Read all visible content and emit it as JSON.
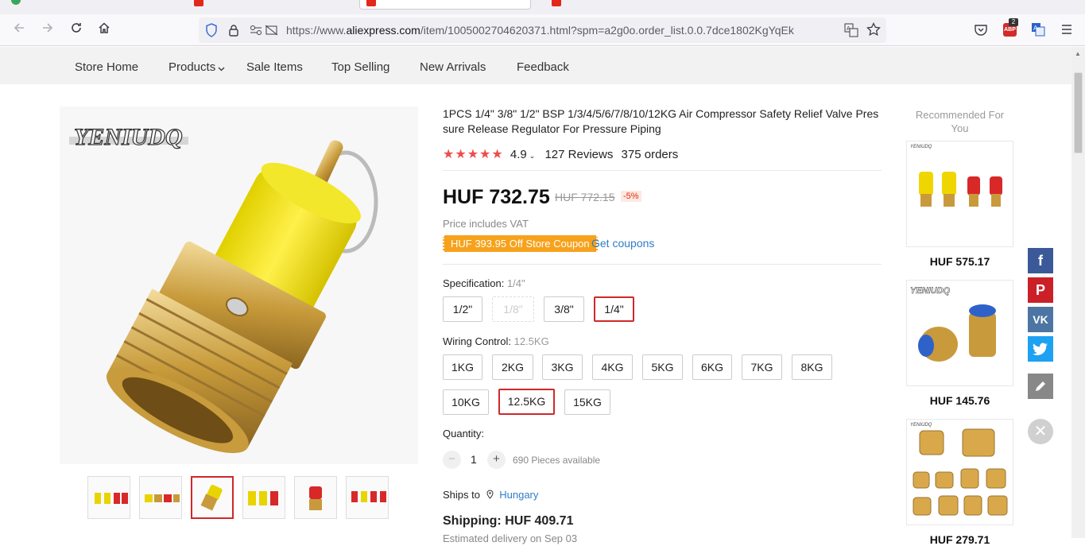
{
  "browser": {
    "url_prefix": "https://www.",
    "url_domain": "aliexpress.com",
    "url_rest": "/item/1005002704620371.html?spm=a2g0o.order_list.0.0.7dce1802KgYqEk",
    "abp_badge": "2"
  },
  "store_nav": [
    "Store Home",
    "Products",
    "Sale Items",
    "Top Selling",
    "New Arrivals",
    "Feedback"
  ],
  "gallery": {
    "brand": "YENIUDQ",
    "selected_thumb": 2
  },
  "product": {
    "title": "1PCS 1/4\" 3/8\" 1/2\" BSP 1/3/4/5/6/7/8/10/12KG Air Compressor Safety Relief Valve Pressure Release Regulator For Pressure Piping",
    "stars": "★★★★★",
    "rating": "4.9",
    "reviews": "127 Reviews",
    "orders": "375 orders",
    "price": "HUF 732.75",
    "old_price": "HUF 772.15",
    "discount": "-5%",
    "vat": "Price includes VAT",
    "coupon": "HUF 393.95 Off Store Coupon",
    "get_coupons": "Get coupons"
  },
  "specification": {
    "label": "Specification:",
    "selected": "1/4\"",
    "options": [
      "1/2\"",
      "1/8\"",
      "3/8\"",
      "1/4\""
    ]
  },
  "wiring": {
    "label": "Wiring Control:",
    "selected": "12.5KG",
    "options": [
      "1KG",
      "2KG",
      "3KG",
      "4KG",
      "5KG",
      "6KG",
      "7KG",
      "8KG",
      "10KG",
      "12.5KG",
      "15KG"
    ]
  },
  "quantity": {
    "label": "Quantity:",
    "value": "1",
    "minus": "−",
    "plus": "+",
    "available": "690 Pieces available"
  },
  "shipping": {
    "ships_to_label": "Ships to",
    "country": "Hungary",
    "cost": "Shipping: HUF 409.71",
    "delivery": "Estimated delivery on Sep 03"
  },
  "recommended": {
    "title": "Recommended For You",
    "items": [
      {
        "price": "HUF 575.17"
      },
      {
        "price": "HUF 145.76"
      },
      {
        "price": "HUF 279.71"
      }
    ]
  },
  "colors": {
    "accent_red": "#d0282a",
    "star_red": "#f04c4c",
    "coupon_orange": "#f7a21c",
    "link_blue": "#2e7dc6",
    "facebook": "#3b5998",
    "pinterest": "#cb2027",
    "vk": "#4c75a3",
    "twitter": "#1da1f2",
    "edit": "#888888"
  },
  "share_icons": [
    "facebook-icon",
    "pinterest-icon",
    "vk-icon",
    "twitter-icon",
    "edit-icon",
    "close-icon"
  ]
}
